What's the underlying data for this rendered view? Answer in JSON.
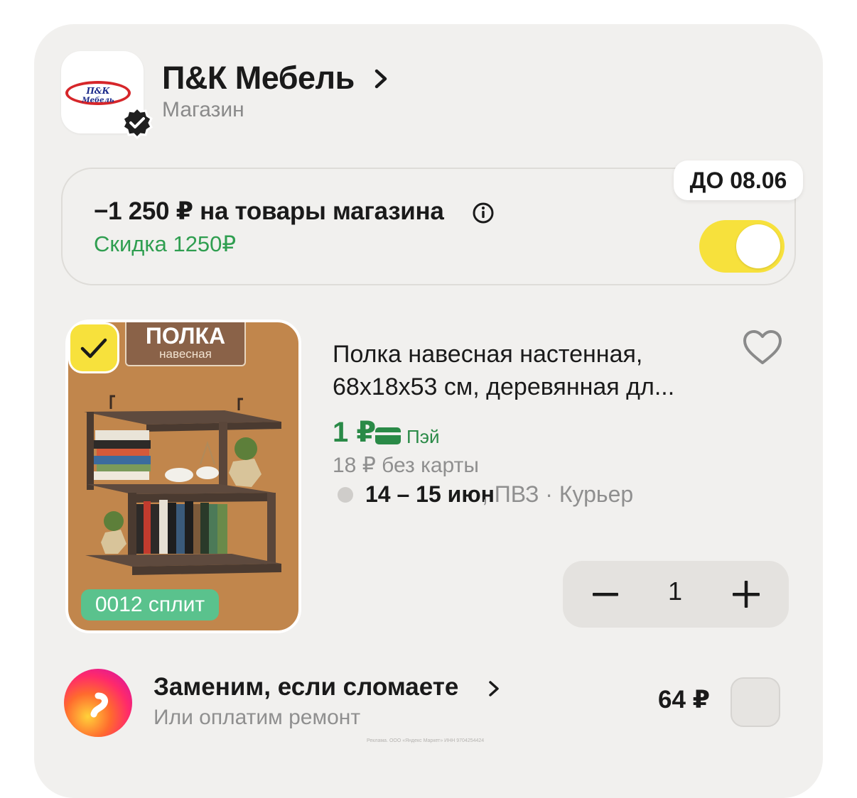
{
  "shop": {
    "name": "П&К Мебель",
    "type": "Магазин",
    "logo_text_top": "П&К",
    "logo_text_bottom": "Мебель"
  },
  "promo": {
    "title": "−1 250 ₽ на товары магазина",
    "subtitle": "Скидка 1250₽",
    "deadline": "ДО 08.06",
    "toggle_on": true
  },
  "product": {
    "image_banner_title": "ПОЛКА",
    "image_banner_subtitle": "навесная",
    "split_badge": "0012 сплит",
    "title_line1": "Полка навесная настенная,",
    "title_line2": "68x18x53 см, деревянная дл...",
    "price": "1 ₽",
    "pay_label": "Пэй",
    "price_without_card": "18 ₽  без карты",
    "delivery_dates": "14 – 15 июн",
    "delivery_methods": ", ПВЗ · Курьер",
    "quantity": "1",
    "selected": true
  },
  "warranty": {
    "title": "Заменим, если сломаете",
    "subtitle": "Или оплатим ремонт",
    "price": "64 ₽"
  },
  "footer": {
    "ad_note": "Реклама. ООО «Яндекс Маркет» ИНН 9704254424"
  },
  "colors": {
    "accent_yellow": "#f7e13c",
    "discount_green": "#2f9e50",
    "card_bg": "#f1f0ee"
  }
}
